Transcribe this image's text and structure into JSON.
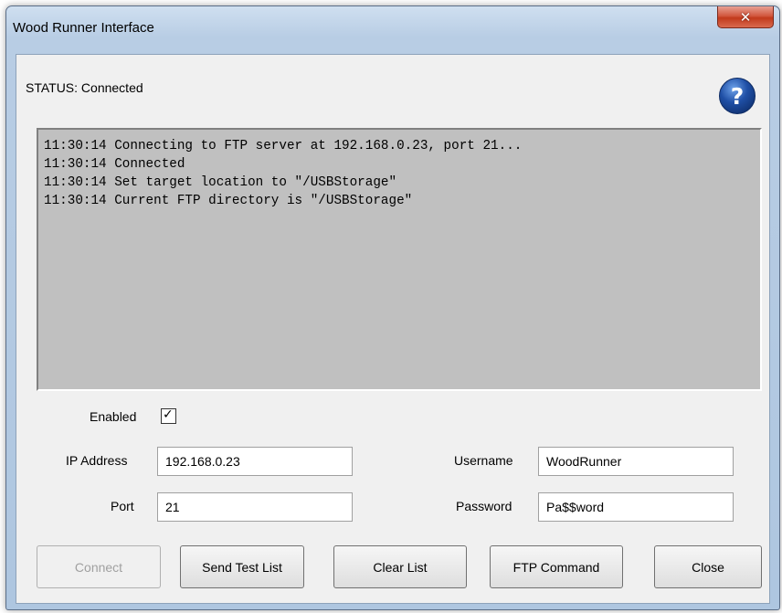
{
  "window": {
    "title": "Wood Runner Interface",
    "close_glyph": "✕"
  },
  "status": {
    "text": "STATUS: Connected"
  },
  "help": {
    "glyph": "?"
  },
  "log": {
    "lines": [
      "11:30:14 Connecting to FTP server at 192.168.0.23, port 21...",
      "11:30:14 Connected",
      "11:30:14 Set target location to \"/USBStorage\"",
      "11:30:14 Current FTP directory is \"/USBStorage\""
    ]
  },
  "form": {
    "enabled_label": "Enabled",
    "enabled_checked": true,
    "checkmark_glyph": "✓",
    "ip_label": "IP Address",
    "ip_value": "192.168.0.23",
    "port_label": "Port",
    "port_value": "21",
    "username_label": "Username",
    "username_value": "WoodRunner",
    "password_label": "Password",
    "password_value": "Pa$$word"
  },
  "buttons": {
    "connect": "Connect",
    "send_test_list": "Send Test List",
    "clear_list": "Clear List",
    "ftp_command": "FTP Command",
    "close": "Close"
  },
  "colors": {
    "frame": "#b8cde4",
    "close_button": "#c23a1c",
    "log_background": "#c0c0c0",
    "help_icon": "#1f4fa6"
  }
}
